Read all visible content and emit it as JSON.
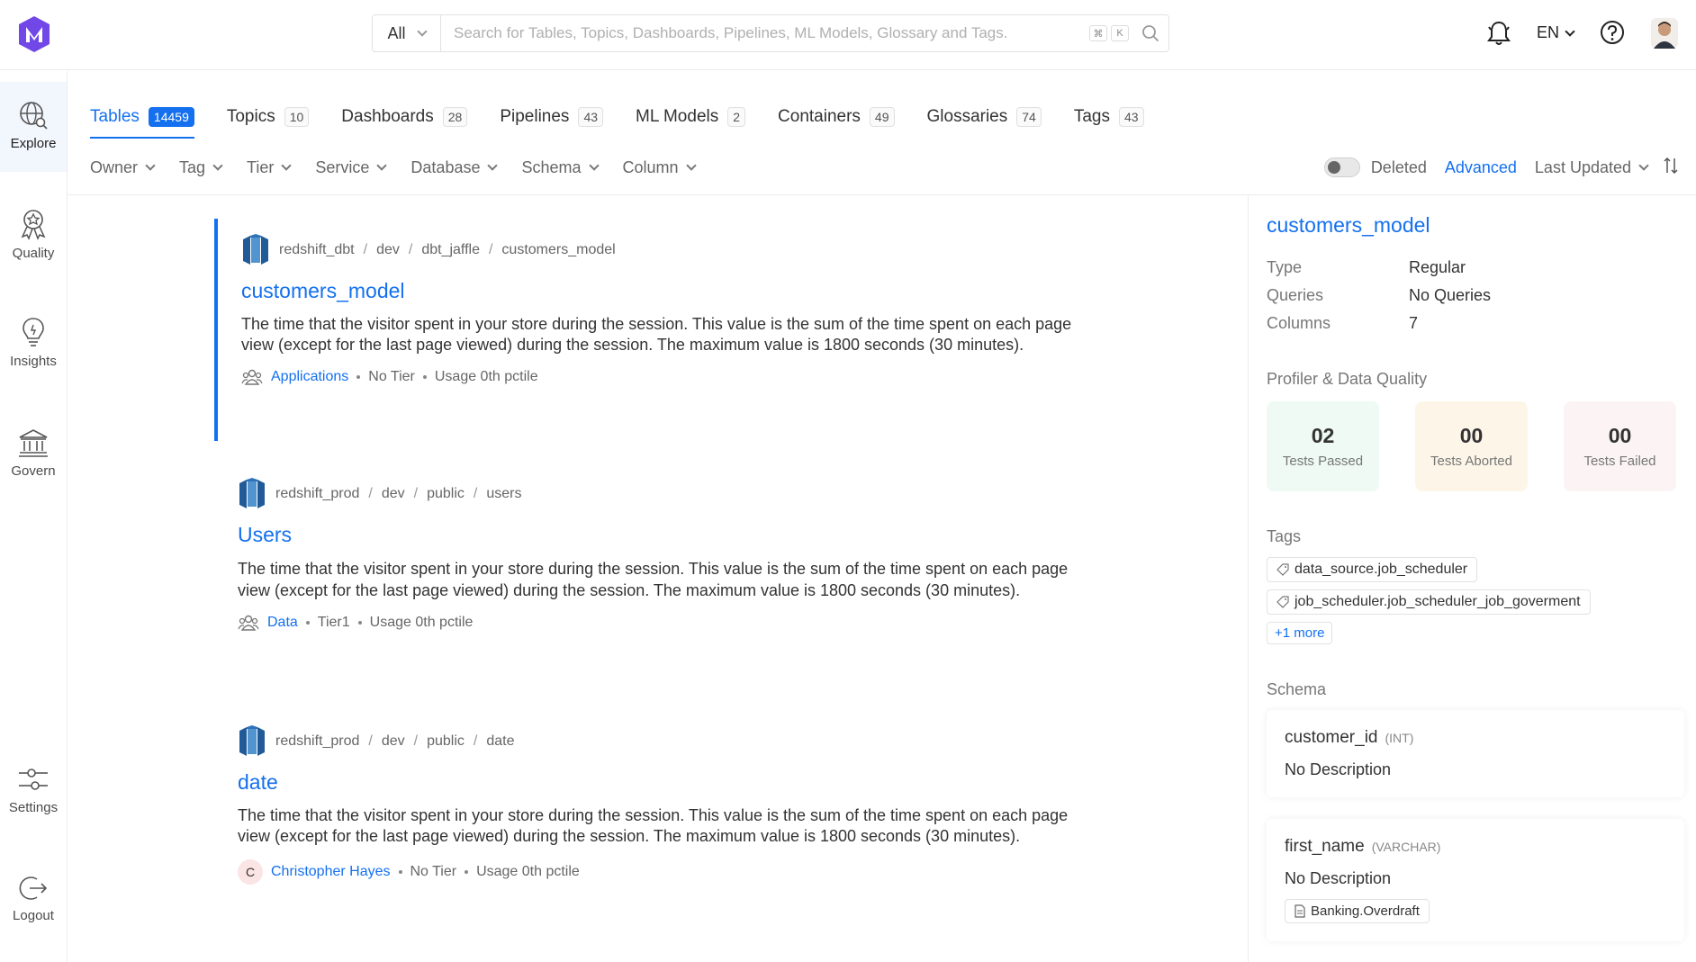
{
  "search": {
    "scope": "All",
    "placeholder": "Search for Tables, Topics, Dashboards, Pipelines, ML Models, Glossary and Tags.",
    "shortcut_key1": "⌘",
    "shortcut_key2": "K"
  },
  "header": {
    "language": "EN"
  },
  "sidebar": {
    "items": [
      {
        "label": "Explore",
        "icon": "explore-icon"
      },
      {
        "label": "Quality",
        "icon": "quality-icon"
      },
      {
        "label": "Insights",
        "icon": "insights-icon"
      },
      {
        "label": "Govern",
        "icon": "govern-icon"
      },
      {
        "label": "Settings",
        "icon": "settings-icon"
      },
      {
        "label": "Logout",
        "icon": "logout-icon"
      }
    ]
  },
  "tabs": [
    {
      "label": "Tables",
      "count": "14459"
    },
    {
      "label": "Topics",
      "count": "10"
    },
    {
      "label": "Dashboards",
      "count": "28"
    },
    {
      "label": "Pipelines",
      "count": "43"
    },
    {
      "label": "ML Models",
      "count": "2"
    },
    {
      "label": "Containers",
      "count": "49"
    },
    {
      "label": "Glossaries",
      "count": "74"
    },
    {
      "label": "Tags",
      "count": "43"
    }
  ],
  "filters": [
    "Owner",
    "Tag",
    "Tier",
    "Service",
    "Database",
    "Schema",
    "Column"
  ],
  "toolbar": {
    "deleted": "Deleted",
    "advanced": "Advanced",
    "sort": "Last Updated"
  },
  "results": [
    {
      "crumbs": [
        "redshift_dbt",
        "dev",
        "dbt_jaffle",
        "customers_model"
      ],
      "name": "customers_model",
      "description": "The time that the visitor spent in your store during the session. This value is the sum of the time spent on each page view (except for the last page viewed) during the session. The maximum value is 1800 seconds (30 minutes).",
      "owner": "Applications",
      "tier": "No Tier",
      "usage": "Usage 0th pctile"
    },
    {
      "crumbs": [
        "redshift_prod",
        "dev",
        "public",
        "users"
      ],
      "name": "Users",
      "description": "The time that the visitor spent in your store during the session. This value is the sum of the time spent on each page view (except for the last page viewed) during the session. The maximum value is 1800 seconds (30 minutes).",
      "owner": "Data",
      "tier": "Tier1",
      "usage": "Usage 0th pctile"
    },
    {
      "crumbs": [
        "redshift_prod",
        "dev",
        "public",
        "date"
      ],
      "name": "date",
      "description": "The time that the visitor spent in your store during the session. This value is the sum of the time spent on each page view (except for the last page viewed) during the session. The maximum value is 1800 seconds (30 minutes).",
      "owner": "Christopher Hayes",
      "owner_initial": "C",
      "tier": "No Tier",
      "usage": "Usage 0th pctile"
    }
  ],
  "details": {
    "title": "customers_model",
    "props": [
      {
        "k": "Type",
        "v": "Regular"
      },
      {
        "k": "Queries",
        "v": "No Queries"
      },
      {
        "k": "Columns",
        "v": "7"
      }
    ],
    "dq_title": "Profiler & Data Quality",
    "dq": [
      {
        "n": "02",
        "l": "Tests Passed",
        "bg": "#eefaf3"
      },
      {
        "n": "00",
        "l": "Tests Aborted",
        "bg": "#fdf6e8"
      },
      {
        "n": "00",
        "l": "Tests Failed",
        "bg": "#fcf4f4"
      }
    ],
    "tags_title": "Tags",
    "tags": [
      "data_source.job_scheduler",
      "job_scheduler.job_scheduler_job_goverment"
    ],
    "more": "+1 more",
    "schema_title": "Schema",
    "columns": [
      {
        "name": "customer_id",
        "type": "(INT)",
        "desc": "No Description"
      },
      {
        "name": "first_name",
        "type": "(VARCHAR)",
        "desc": "No Description",
        "glossary": "Banking.Overdraft"
      }
    ]
  },
  "colors": {
    "accent": "#1470ef"
  }
}
